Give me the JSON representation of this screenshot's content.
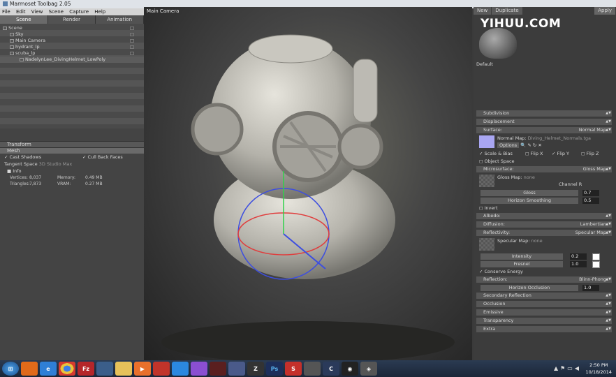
{
  "window": {
    "title": "Marmoset Toolbag 2.05"
  },
  "menu": [
    "File",
    "Edit",
    "View",
    "Scene",
    "Capture",
    "Help"
  ],
  "left_tabs": [
    "Scene",
    "Render",
    "Animation"
  ],
  "scene_tree": [
    {
      "label": "Scene",
      "indent": 0
    },
    {
      "label": "Sky",
      "indent": 1
    },
    {
      "label": "Main Camera",
      "indent": 1
    },
    {
      "label": "hydrant_lp",
      "indent": 1
    },
    {
      "label": "scuba_lp",
      "indent": 1
    },
    {
      "label": "NadelynLee_DivingHelmet_LowPoly",
      "indent": 2
    }
  ],
  "transform_header": "Transform",
  "mesh_header": "Mesh",
  "mesh": {
    "cast_shadows": "Cast Shadows",
    "cull_back_faces": "Cull Back Faces",
    "tangent_space_label": "Tangent Space",
    "tangent_space_value": "3D Studio Max",
    "info_header": "Info",
    "vertices_label": "Vertices:",
    "vertices_value": "8,037",
    "memory_label": "Memory:",
    "memory_value": "0.49 MB",
    "triangles_label": "Triangles:",
    "triangles_value": "7,873",
    "vram_label": "VRAM:",
    "vram_value": "0.27 MB"
  },
  "viewport": {
    "label": "Main Camera"
  },
  "right": {
    "new": "New",
    "duplicate": "Duplicate",
    "apply": "Apply",
    "watermark": "YIHUU.COM",
    "material_name": "Default",
    "sections": {
      "subdivision": "Subdivision",
      "displacement": "Displacement",
      "surface": "Surface:",
      "surface_value": "Normal Map",
      "normal_map_label": "Normal Map:",
      "normal_map_file": "Diving_Helmet_Normals.tga",
      "options": "Options",
      "scale_bias": "Scale & Bias",
      "flip_x": "Flip X",
      "flip_y": "Flip Y",
      "flip_z": "Flip Z",
      "object_space": "Object Space",
      "microsurface": "Microsurface:",
      "microsurface_value": "Gloss Map",
      "gloss_map_label": "Gloss Map:",
      "gloss_map_file": "none",
      "channel": "Channel",
      "channel_value": "R",
      "gloss": "Gloss",
      "gloss_value": "0.7",
      "horizon_smoothing": "Horizon Smoothing",
      "horizon_smoothing_value": "0.5",
      "invert": "Invert",
      "albedo": "Albedo:",
      "diffusion": "Diffusion:",
      "diffusion_value": "Lambertian",
      "reflectivity": "Reflectivity:",
      "reflectivity_value": "Specular Map",
      "specular_map_label": "Specular Map:",
      "specular_map_file": "none",
      "intensity": "Intensity",
      "intensity_value": "0.2",
      "fresnel": "Fresnel",
      "fresnel_value": "1.0",
      "conserve_energy": "Conserve Energy",
      "reflection": "Reflection:",
      "reflection_value": "Blinn-Phong",
      "horizon_occlusion": "Horizon Occlusion",
      "horizon_occlusion_value": "1.0",
      "secondary_reflection": "Secondary Reflection",
      "occlusion": "Occlusion",
      "emissive": "Emissive",
      "transparency": "Transparency",
      "extra": "Extra"
    }
  },
  "taskbar": {
    "time": "2:50 PM",
    "date": "10/18/2014",
    "apps": [
      "start",
      "firefox",
      "internet-explorer",
      "chrome",
      "filezilla",
      "maya",
      "explorer",
      "media",
      "unity",
      "dropbox",
      "photoshop-like",
      "marmoset",
      "monitor",
      "zbrush",
      "photoshop",
      "snagit",
      "toolbag",
      "cinema",
      "obs",
      "marmoset2"
    ]
  }
}
